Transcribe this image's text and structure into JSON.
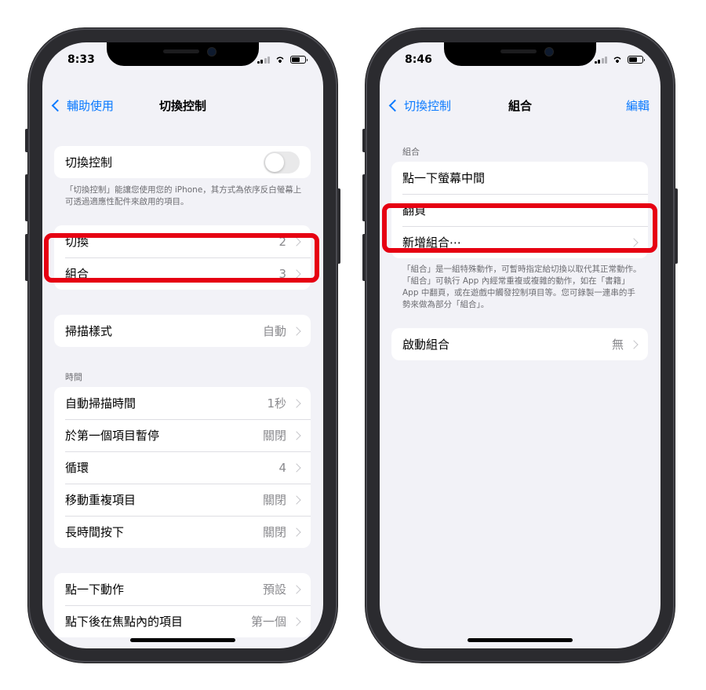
{
  "left": {
    "status_time": "8:33",
    "nav": {
      "back_label": "輔助使用",
      "title": "切換控制"
    },
    "toggle_row": {
      "label": "切換控制"
    },
    "toggle_footnote": "「切換控制」能讓您使用您的 iPhone，其方式為依序反白螢幕上可透過適應性配件來啟用的項目。",
    "group1": [
      {
        "label": "切換",
        "value": "2"
      },
      {
        "label": "組合",
        "value": "3"
      }
    ],
    "group2": [
      {
        "label": "掃描樣式",
        "value": "自動"
      }
    ],
    "time_header": "時間",
    "group3": [
      {
        "label": "自動掃描時間",
        "value": "1秒"
      },
      {
        "label": "於第一個項目暫停",
        "value": "關閉"
      },
      {
        "label": "循環",
        "value": "4"
      },
      {
        "label": "移動重複項目",
        "value": "關閉"
      },
      {
        "label": "長時間按下",
        "value": "關閉"
      }
    ],
    "group4": [
      {
        "label": "點一下動作",
        "value": "預設"
      },
      {
        "label": "點下後在焦點內的項目",
        "value": "第一個"
      }
    ]
  },
  "right": {
    "status_time": "8:46",
    "nav": {
      "back_label": "切換控制",
      "title": "組合",
      "edit_label": "編輯"
    },
    "section_header": "組合",
    "recipes": [
      {
        "label": "點一下螢幕中間"
      },
      {
        "label": "翻頁"
      },
      {
        "label": "新增組合⋯"
      }
    ],
    "footnote": "「組合」是一組特殊動作，可暫時指定給切換以取代其正常動作。「組合」可執行 App 內經常重複或複雜的動作，如在「書籍」App 中翻頁，或在遊戲中觸發控制項目等。您可錄製一連串的手勢來做為部分「組合」。",
    "launch": {
      "label": "啟動組合",
      "value": "無"
    }
  },
  "colors": {
    "accent": "#0a7aff",
    "highlight": "#e60012",
    "background": "#f2f2f7"
  }
}
